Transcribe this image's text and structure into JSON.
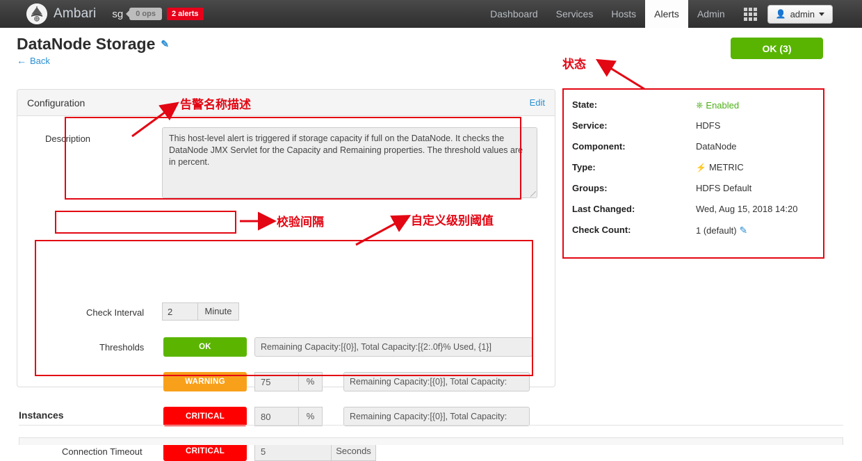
{
  "navbar": {
    "brand": "Ambari",
    "cluster": "sg",
    "ops_badge": "0 ops",
    "alerts_badge": "2 alerts",
    "links": [
      {
        "label": "Dashboard",
        "active": false
      },
      {
        "label": "Services",
        "active": false
      },
      {
        "label": "Hosts",
        "active": false
      },
      {
        "label": "Alerts",
        "active": true
      },
      {
        "label": "Admin",
        "active": false
      }
    ],
    "grid_icon": "grid-icon",
    "admin_button": "admin",
    "admin_icon": "user-icon"
  },
  "page": {
    "title": "DataNode Storage",
    "title_edit_icon": "pencil-icon",
    "back_label": "Back",
    "back_icon": "arrow-left-icon",
    "ok_button": "OK (3)"
  },
  "config": {
    "panel_title": "Configuration",
    "edit_link": "Edit",
    "description_label": "Description",
    "description_value": "This host-level alert is triggered if storage capacity if full on the DataNode. It checks the DataNode JMX Servlet for the Capacity and Remaining properties. The threshold values are in percent.",
    "check_interval_label": "Check Interval",
    "check_interval_value": "2",
    "check_interval_unit": "Minute",
    "thresholds_label": "Thresholds",
    "connection_timeout_label": "Connection Timeout",
    "rows": [
      {
        "severity": "OK",
        "value": "",
        "unit": "",
        "text": "Remaining Capacity:[{0}], Total Capacity:[{2:.0f}% Used, {1}]"
      },
      {
        "severity": "WARNING",
        "value": "75",
        "unit": "%",
        "text": "Remaining Capacity:[{0}], Total Capacity:"
      },
      {
        "severity": "CRITICAL",
        "value": "80",
        "unit": "%",
        "text": "Remaining Capacity:[{0}], Total Capacity:"
      }
    ],
    "timeout_row": {
      "severity": "CRITICAL",
      "value": "5",
      "unit": "Seconds"
    }
  },
  "info": {
    "rows": [
      {
        "key": "State:",
        "value": "Enabled",
        "icon": "power-icon",
        "green": true
      },
      {
        "key": "Service:",
        "value": "HDFS",
        "icon": "",
        "green": false
      },
      {
        "key": "Component:",
        "value": "DataNode",
        "icon": "",
        "green": false
      },
      {
        "key": "Type:",
        "value": "METRIC",
        "icon": "bolt-icon",
        "green": false
      },
      {
        "key": "Groups:",
        "value": "HDFS Default",
        "icon": "",
        "green": false
      },
      {
        "key": "Last Changed:",
        "value": "Wed, Aug 15, 2018 14:20",
        "icon": "",
        "green": false
      },
      {
        "key": "Check Count:",
        "value": "1 (default)",
        "icon": "pencil-icon",
        "green": false
      }
    ]
  },
  "instances": {
    "title": "Instances"
  },
  "annotations": [
    {
      "text": "状态",
      "name": "annotation-state"
    },
    {
      "text": "告警名称描述",
      "name": "annotation-alert-description"
    },
    {
      "text": "校验间隔",
      "name": "annotation-check-interval"
    },
    {
      "text": "自定义级别阈值",
      "name": "annotation-custom-thresholds"
    }
  ],
  "colors": {
    "accent_link": "#2a8fd4",
    "ok_green": "#5bb500",
    "warning_orange": "#f9a01b",
    "critical_red": "#fe0000",
    "annotation_red": "#e30613",
    "navbar_dark": "#3a3a3a"
  }
}
